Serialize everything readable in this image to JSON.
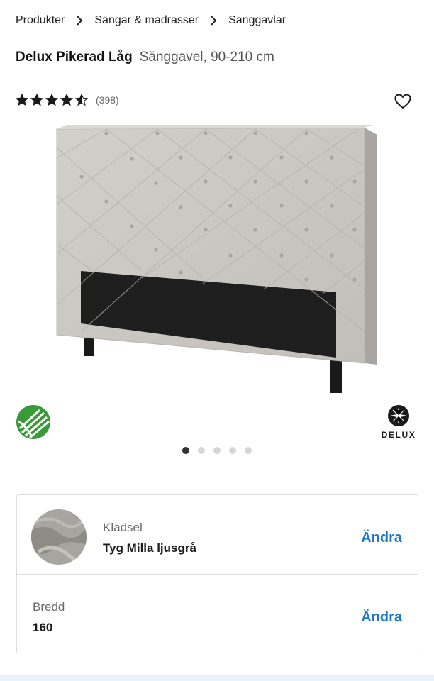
{
  "breadcrumb": {
    "items": [
      "Produkter",
      "Sängar & madrasser",
      "Sänggavlar"
    ]
  },
  "product": {
    "name": "Delux Pikerad Låg",
    "subtitle": "Sänggavel, 90-210 cm",
    "rating": 4.5,
    "rating_max": 5,
    "review_count": "(398)"
  },
  "gallery": {
    "image_count": 5,
    "active_index": 1
  },
  "badges": {
    "brand_text": "DELUX"
  },
  "options": [
    {
      "label": "Klädsel",
      "value": "Tyg Milla ljusgrå",
      "action": "Ändra"
    },
    {
      "label": "Bredd",
      "value": "160",
      "action": "Ändra"
    }
  ],
  "colors": {
    "accent": "#1f78c2",
    "fabric": "#c8c4bf",
    "base": "#1c1c1c",
    "nordic_swan": "#3a9a3a"
  }
}
